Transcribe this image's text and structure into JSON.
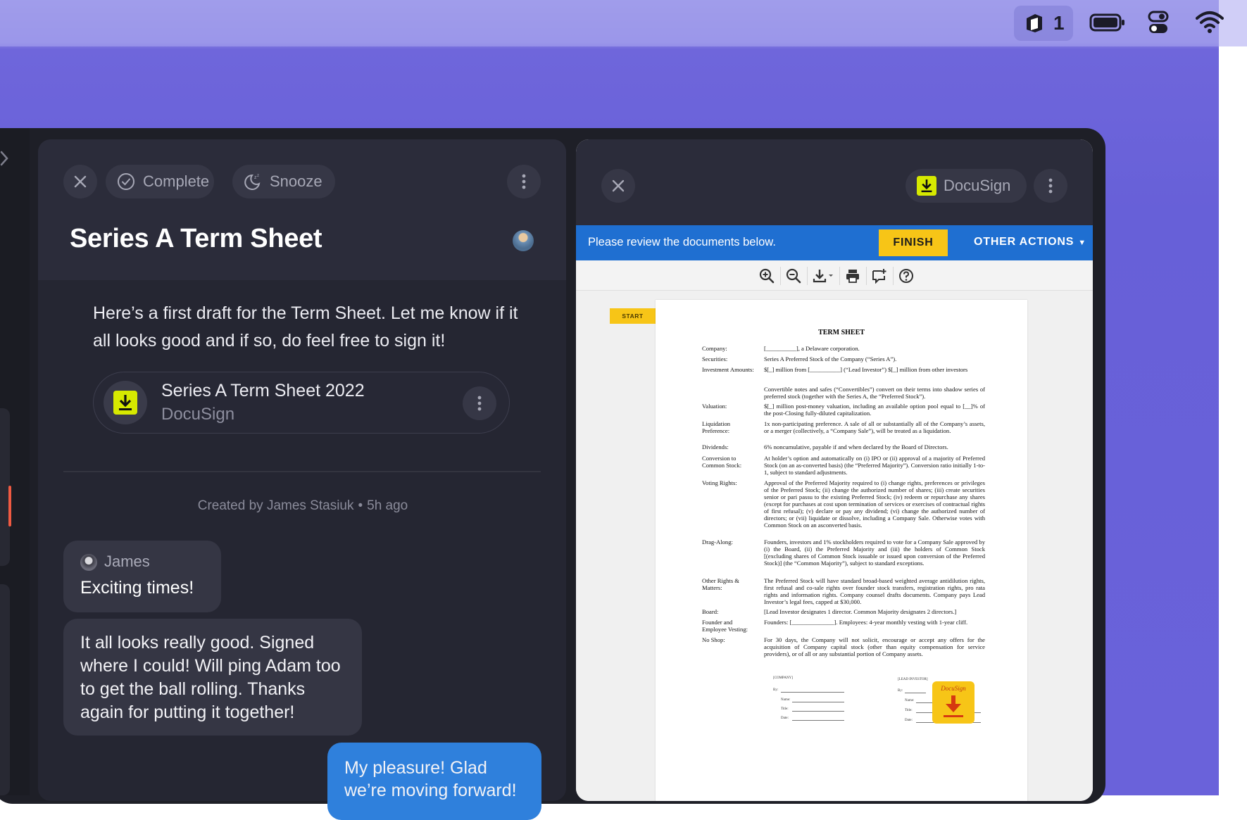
{
  "menubar": {
    "workspace_count": "1",
    "icons": [
      "app-icon",
      "battery-icon",
      "control-center-icon",
      "wifi-icon"
    ]
  },
  "left_card": {
    "toolbar": {
      "complete_label": "Complete",
      "snooze_label": "Snooze"
    },
    "title": "Series A Term Sheet",
    "message": "Here’s a first draft for the Term Sheet. Let me know if it all looks good and if so, do feel free to sign it!",
    "attachment": {
      "title": "Series A Term Sheet 2022",
      "source": "DocuSign"
    },
    "meta": {
      "created_by": "Created by James Stasiuk",
      "time": "5h ago"
    },
    "messages": [
      {
        "author": "James",
        "text": "Exciting times!"
      },
      {
        "text": "It all looks really good. Signed where I could! Will ping Adam too to get the ball rolling. Thanks again for putting it together!"
      },
      {
        "text": "My pleasure! Glad we’re moving forward!"
      }
    ]
  },
  "right_card": {
    "app_label": "DocuSign",
    "review_text": "Please review the documents below.",
    "finish_label": "FINISH",
    "other_actions_label": "OTHER ACTIONS",
    "start_label": "START",
    "document": {
      "title": "TERM SHEET",
      "rows": [
        {
          "label": "Company:",
          "value": "[__________], a Delaware corporation."
        },
        {
          "label": "Securities:",
          "value": "Series A Preferred Stock of the Company (“Series A”)."
        },
        {
          "label": "Investment Amounts:",
          "value": "$[_] million from [__________] (“Lead Investor”) $[_] million from other investors"
        },
        {
          "label": "",
          "value": "Convertible notes and safes (“Convertibles”) convert on their terms into shadow series of preferred stock (together with the Series A, the “Preferred Stock”)."
        },
        {
          "label": "Valuation:",
          "value": "$[_] million post-money valuation, including an available option pool equal to [__]% of the post-Closing fully-diluted capitalization."
        },
        {
          "label": "Liquidation Preference:",
          "value": "1x non-participating preference. A sale of all or substantially all of the Company’s assets, or a merger (collectively, a “Company Sale”), will be treated as a liquidation."
        },
        {
          "label": "Dividends:",
          "value": "6% noncumulative, payable if and when declared by the Board of Directors."
        },
        {
          "label": "Conversion to Common Stock:",
          "value": "At holder’s option and automatically on (i) IPO or (ii) approval of a majority of Preferred Stock (on an as-converted basis) (the “Preferred Majority”). Conversion ratio initially 1-to-1, subject to standard adjustments."
        },
        {
          "label": "Voting Rights:",
          "value": "Approval of the Preferred Majority required to (i) change rights, preferences or privileges of the Preferred Stock; (ii) change the authorized number of shares; (iii) create securities senior or pari passu to the existing Preferred Stock; (iv) redeem or repurchase any shares (except for purchases at cost upon termination of services or exercises of contractual rights of first refusal); (v) declare or pay any dividend; (vi) change the authorized number of directors; or (vii) liquidate or dissolve, including a Company Sale. Otherwise votes with Common Stock on an asconverted basis."
        },
        {
          "label": "Drag-Along:",
          "value": "Founders, investors and 1% stockholders required to vote for a Company Sale approved by (i) the Board, (ii) the Preferred Majority and (iii) the holders of Common Stock [(excluding shares of Common Stock issuable or issued upon conversion of the Preferred Stock)] (the “Common Majority”), subject to standard exceptions."
        },
        {
          "label": "Other Rights & Matters:",
          "value": "The Preferred Stock will have standard broad-based weighted average antidilution rights, first refusal and co-sale rights over founder stock transfers, registration rights, pro rata rights and information rights. Company counsel drafts documents. Company pays Lead Investor’s legal fees, capped at $30,000."
        },
        {
          "label": "Board:",
          "value": "[Lead Investor designates 1 director. Common Majority designates 2 directors.]"
        },
        {
          "label": "Founder and Employee Vesting:",
          "value": "Founders: [______________]. Employees: 4-year monthly vesting with 1-year cliff."
        },
        {
          "label": "No Shop:",
          "value": "For 30 days, the Company will not solicit, encourage or accept any offers for the acquisition of Company capital stock (other than equity compensation for service providers), or of all or any substantial portion of Company assets."
        }
      ],
      "sig_company": "[COMPANY]",
      "sig_investor": "[LEAD INVESTOR]",
      "sig_fields": [
        "By:",
        "Name:",
        "Title:",
        "Date:"
      ],
      "stamp_label": "DocuSign"
    }
  }
}
